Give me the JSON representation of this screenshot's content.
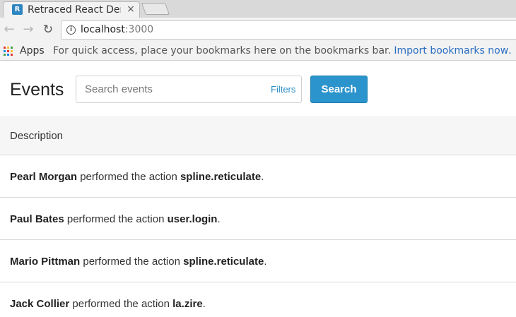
{
  "browser": {
    "tab_title": "Retraced React Demo",
    "tab_favicon_letter": "R",
    "tab_close": "×",
    "url_host": "localhost",
    "url_port": ":3000",
    "apps_label": "Apps",
    "bookmarks_hint": "For quick access, place your bookmarks here on the bookmarks bar.",
    "bookmarks_import": "Import bookmarks now…"
  },
  "page": {
    "title": "Events",
    "search_placeholder": "Search events",
    "filters_label": "Filters",
    "search_button": "Search"
  },
  "table": {
    "header": "Description",
    "action_phrase": "performed the action",
    "rows": [
      {
        "actor": "Pearl Morgan",
        "action": "spline.reticulate"
      },
      {
        "actor": "Paul Bates",
        "action": "user.login"
      },
      {
        "actor": "Mario Pittman",
        "action": "spline.reticulate"
      },
      {
        "actor": "Jack Collier",
        "action": "la.zire"
      }
    ]
  },
  "colors": {
    "accent": "#2b94cc",
    "link": "#2a8fc7"
  }
}
